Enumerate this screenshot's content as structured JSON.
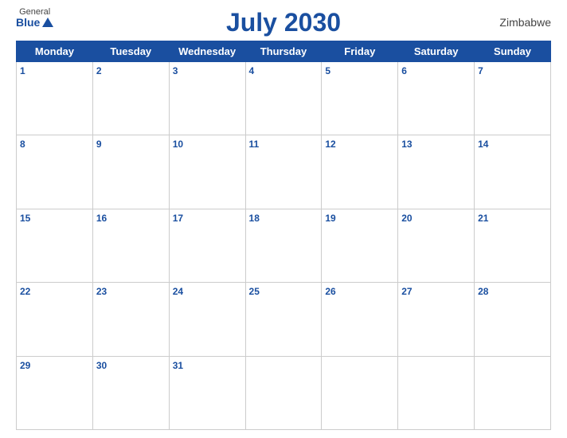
{
  "header": {
    "logo": {
      "general": "General",
      "blue": "Blue"
    },
    "title": "July 2030",
    "country": "Zimbabwe"
  },
  "weekdays": [
    "Monday",
    "Tuesday",
    "Wednesday",
    "Thursday",
    "Friday",
    "Saturday",
    "Sunday"
  ],
  "weeks": [
    [
      {
        "day": "1",
        "empty": false
      },
      {
        "day": "2",
        "empty": false
      },
      {
        "day": "3",
        "empty": false
      },
      {
        "day": "4",
        "empty": false
      },
      {
        "day": "5",
        "empty": false
      },
      {
        "day": "6",
        "empty": false
      },
      {
        "day": "7",
        "empty": false
      }
    ],
    [
      {
        "day": "8",
        "empty": false
      },
      {
        "day": "9",
        "empty": false
      },
      {
        "day": "10",
        "empty": false
      },
      {
        "day": "11",
        "empty": false
      },
      {
        "day": "12",
        "empty": false
      },
      {
        "day": "13",
        "empty": false
      },
      {
        "day": "14",
        "empty": false
      }
    ],
    [
      {
        "day": "15",
        "empty": false
      },
      {
        "day": "16",
        "empty": false
      },
      {
        "day": "17",
        "empty": false
      },
      {
        "day": "18",
        "empty": false
      },
      {
        "day": "19",
        "empty": false
      },
      {
        "day": "20",
        "empty": false
      },
      {
        "day": "21",
        "empty": false
      }
    ],
    [
      {
        "day": "22",
        "empty": false
      },
      {
        "day": "23",
        "empty": false
      },
      {
        "day": "24",
        "empty": false
      },
      {
        "day": "25",
        "empty": false
      },
      {
        "day": "26",
        "empty": false
      },
      {
        "day": "27",
        "empty": false
      },
      {
        "day": "28",
        "empty": false
      }
    ],
    [
      {
        "day": "29",
        "empty": false
      },
      {
        "day": "30",
        "empty": false
      },
      {
        "day": "31",
        "empty": false
      },
      {
        "day": "",
        "empty": true
      },
      {
        "day": "",
        "empty": true
      },
      {
        "day": "",
        "empty": true
      },
      {
        "day": "",
        "empty": true
      }
    ]
  ]
}
